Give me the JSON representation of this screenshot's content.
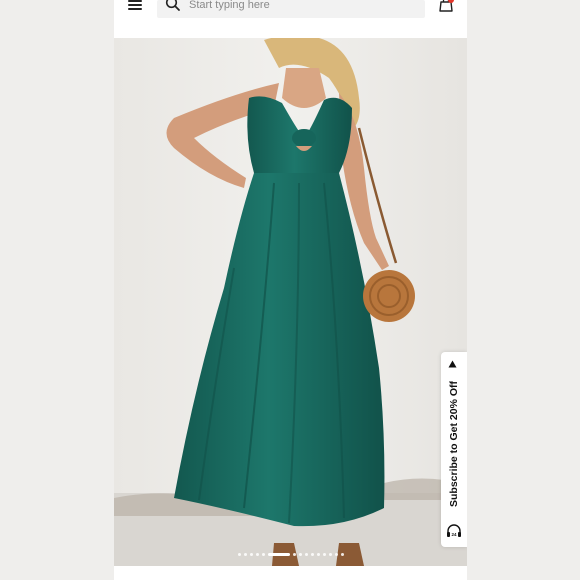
{
  "header": {
    "menu_icon": "hamburger-menu-icon",
    "search": {
      "placeholder": "Start typing here",
      "value": ""
    },
    "cart_icon": "shopping-bag-icon",
    "cart_badge_color": "#e5362b"
  },
  "product": {
    "image_subject": "",
    "dress_color": "#1a6b61"
  },
  "carousel": {
    "total_slides": 15,
    "active_index": 5
  },
  "subscribe_tab": {
    "label": "Subscribe to Get 20% Off",
    "arrow_icon": "triangle-left-icon",
    "support_icon": "headset-24-7-icon"
  }
}
